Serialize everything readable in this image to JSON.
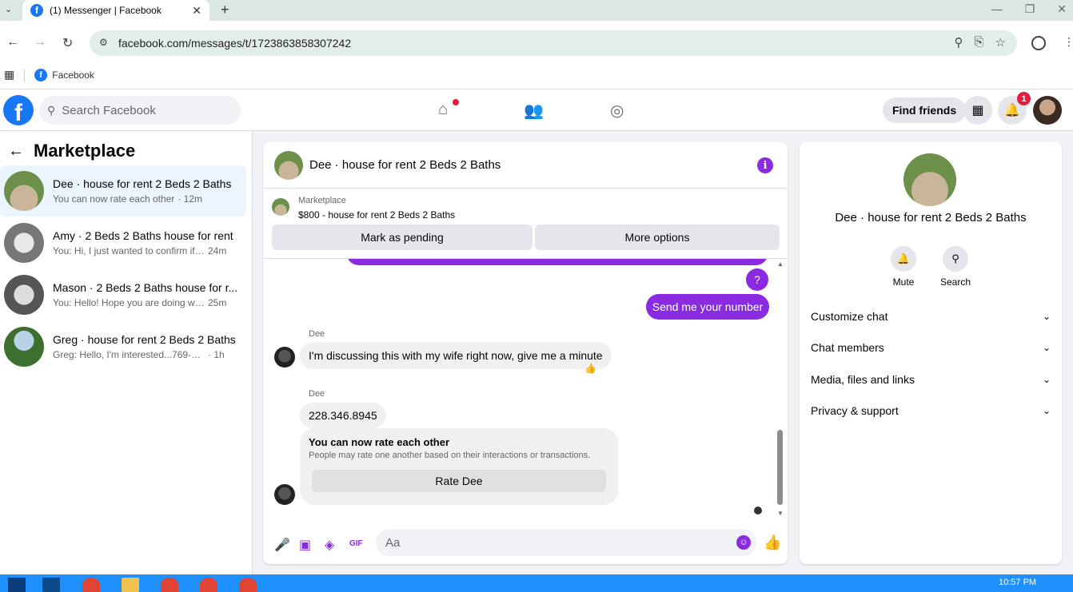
{
  "browser": {
    "tab_title": "(1) Messenger | Facebook",
    "url": "facebook.com/messages/t/1723863858307242",
    "bookmark_label": "Facebook",
    "taskbar_time": "10:57 PM"
  },
  "header": {
    "search_placeholder": "Search Facebook",
    "find_friends_label": "Find friends",
    "notification_count": "1"
  },
  "sidebar": {
    "title": "Marketplace",
    "conversations": [
      {
        "title": "Dee · house for rent 2 Beds 2 Baths",
        "preview": "You can now rate each other",
        "time": "· 12m"
      },
      {
        "title": "Amy · 2 Beds 2 Baths house for rent",
        "preview": "You: Hi, I just wanted to confirm if y...",
        "time": "24m"
      },
      {
        "title": "Mason · 2 Beds 2 Baths house for r...",
        "preview": "You: Hello! Hope you are doing well....",
        "time": "25m"
      },
      {
        "title": "Greg · house for rent 2 Beds 2 Baths",
        "preview": "Greg: Hello, I'm interested...769-232-2...",
        "time": "· 1h"
      }
    ]
  },
  "chat": {
    "title": "Dee · house for rent 2 Beds 2 Baths",
    "marketplace_label": "Marketplace",
    "listing": "$800 - house for rent 2 Beds 2 Baths",
    "mark_pending_label": "Mark as pending",
    "more_options_label": "More options",
    "messages": {
      "out_question": "?",
      "out_number_request": "Send me your number",
      "sender1": "Dee",
      "in_discussing": "I'm discussing this with my wife right now, give me a minute",
      "reaction": "👍",
      "sender2": "Dee",
      "in_number": "228.346.8945",
      "rate_title": "You can now rate each other",
      "rate_sub": "People may rate one another based on their interactions or transactions.",
      "rate_button": "Rate Dee"
    },
    "composer_placeholder": "Aa"
  },
  "right_panel": {
    "name": "Dee · house for rent 2 Beds 2 Baths",
    "mute_label": "Mute",
    "search_label": "Search",
    "sections": [
      "Customize chat",
      "Chat members",
      "Media, files and links",
      "Privacy & support"
    ]
  },
  "colors": {
    "accent": "#8a2be2",
    "fb_blue": "#1877f2",
    "notif_red": "#e41e3f"
  }
}
